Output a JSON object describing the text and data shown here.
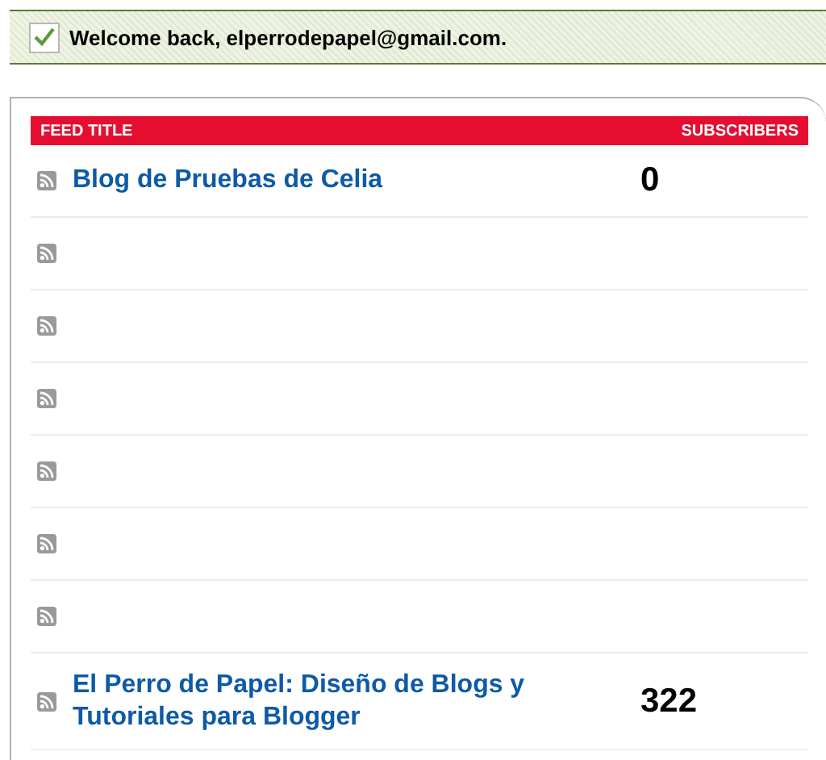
{
  "notice": {
    "text": "Welcome back, elperrodepapel@gmail.com.",
    "checked": true
  },
  "table": {
    "columns": [
      "FEED TITLE",
      "SUBSCRIBERS"
    ],
    "rows": [
      {
        "kind": "feed",
        "title": "Blog de Pruebas de Celia",
        "subscribers": "0"
      },
      {
        "kind": "empty"
      },
      {
        "kind": "empty"
      },
      {
        "kind": "empty"
      },
      {
        "kind": "empty"
      },
      {
        "kind": "empty"
      },
      {
        "kind": "empty"
      },
      {
        "kind": "feed",
        "title": "El Perro de Papel: Diseño de Blogs y Tutoriales para Blogger",
        "subscribers": "322"
      }
    ]
  }
}
